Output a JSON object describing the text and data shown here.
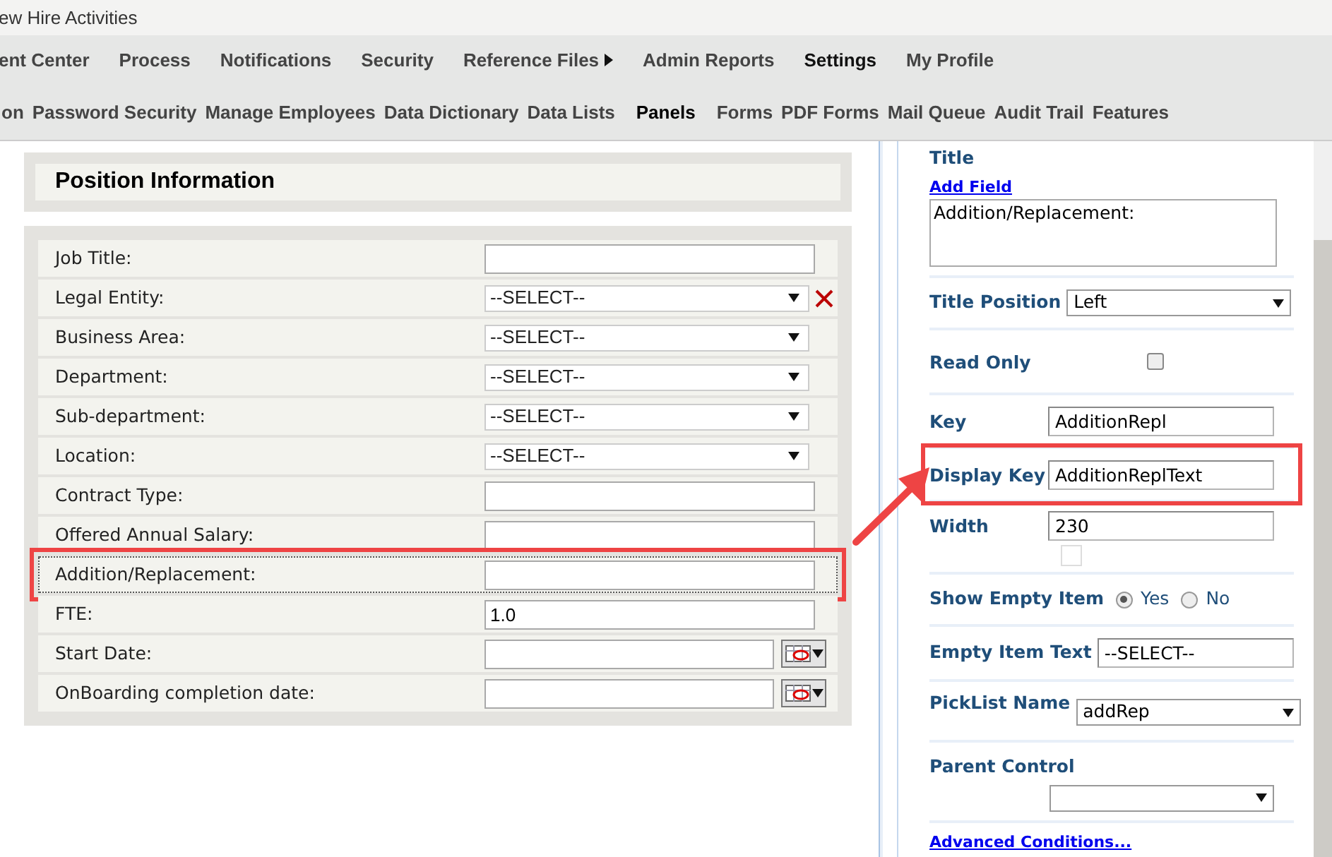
{
  "window": {
    "title": "ew Hire Activities"
  },
  "nav": [
    {
      "label": "ent Center",
      "selected": false,
      "has_submenu": false
    },
    {
      "label": "Process",
      "selected": false,
      "has_submenu": false
    },
    {
      "label": "Notifications",
      "selected": false,
      "has_submenu": false
    },
    {
      "label": "Security",
      "selected": false,
      "has_submenu": false
    },
    {
      "label": "Reference Files",
      "selected": false,
      "has_submenu": true
    },
    {
      "label": "Admin Reports",
      "selected": false,
      "has_submenu": false
    },
    {
      "label": "Settings",
      "selected": true,
      "has_submenu": false
    },
    {
      "label": "My Profile",
      "selected": false,
      "has_submenu": false
    }
  ],
  "subnav": [
    {
      "label": "on",
      "selected": false
    },
    {
      "label": "Password Security",
      "selected": false
    },
    {
      "label": "Manage Employees",
      "selected": false
    },
    {
      "label": "Data Dictionary",
      "selected": false
    },
    {
      "label": "Data Lists",
      "selected": false
    },
    {
      "label": "Panels",
      "selected": true
    },
    {
      "label": "Forms",
      "selected": false
    },
    {
      "label": "PDF Forms",
      "selected": false
    },
    {
      "label": "Mail Queue",
      "selected": false
    },
    {
      "label": "Audit Trail",
      "selected": false
    },
    {
      "label": "Features",
      "selected": false
    }
  ],
  "section": {
    "title": "Position Information"
  },
  "fields": [
    {
      "label": "Job Title:",
      "kind": "text",
      "highlighted": false,
      "removable": false
    },
    {
      "label": "Legal Entity:",
      "kind": "select",
      "value": "--SELECT--",
      "highlighted": false,
      "removable": true
    },
    {
      "label": "Business Area:",
      "kind": "select",
      "value": "--SELECT--",
      "highlighted": false,
      "removable": false
    },
    {
      "label": "Department:",
      "kind": "select",
      "value": "--SELECT--",
      "highlighted": false,
      "removable": false
    },
    {
      "label": "Sub-department:",
      "kind": "select",
      "value": "--SELECT--",
      "highlighted": false,
      "removable": false
    },
    {
      "label": "Location:",
      "kind": "select",
      "value": "--SELECT--",
      "highlighted": false,
      "removable": false
    },
    {
      "label": "Contract Type:",
      "kind": "text",
      "highlighted": false,
      "removable": false
    },
    {
      "label": "Offered Annual Salary:",
      "kind": "text",
      "highlighted": false,
      "removable": false
    },
    {
      "label": "Addition/Replacement:",
      "kind": "text",
      "highlighted": true,
      "removable": false
    },
    {
      "label": "FTE:",
      "kind": "text",
      "value": "1.0",
      "highlighted": false,
      "removable": false
    },
    {
      "label": "Start Date:",
      "kind": "date",
      "highlighted": false,
      "removable": false
    },
    {
      "label": "OnBoarding completion date:",
      "kind": "date",
      "highlighted": false,
      "removable": false
    }
  ],
  "properties": [
    {
      "kind": "textarea",
      "label": "Title",
      "link": "Add Field",
      "value": "Addition/Replacement:",
      "highlighted": false
    },
    {
      "kind": "select",
      "label": "Title Position",
      "value": "Left",
      "highlighted": false
    },
    {
      "kind": "checkbox",
      "label": "Read Only",
      "checked": false,
      "highlighted": false
    },
    {
      "kind": "text",
      "label": "Key",
      "value": "AdditionRepl",
      "highlighted": false
    },
    {
      "kind": "text",
      "label": "Display Key",
      "value": "AdditionReplText",
      "highlighted": true
    },
    {
      "kind": "width",
      "label": "Width",
      "value": "230",
      "checked": false,
      "highlighted": false
    },
    {
      "kind": "radio",
      "label": "Show Empty Item",
      "highlighted": false,
      "options": [
        {
          "label": "Yes",
          "selected": true
        },
        {
          "label": "No",
          "selected": false
        }
      ]
    },
    {
      "kind": "wide-text",
      "label": "Empty Item Text",
      "value": "--SELECT--",
      "highlighted": false
    },
    {
      "kind": "select",
      "label": "PickList Name",
      "value": "addRep",
      "highlighted": false
    },
    {
      "kind": "select-below",
      "label": "Parent Control",
      "highlighted": false
    },
    {
      "kind": "link-textarea",
      "link": "Advanced Conditions...",
      "highlighted": false
    }
  ]
}
